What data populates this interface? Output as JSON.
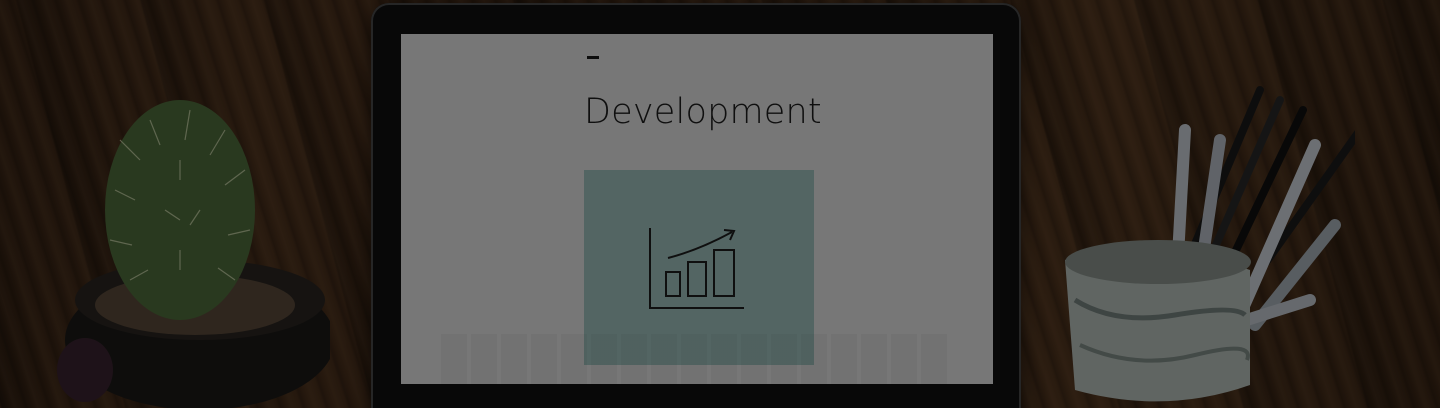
{
  "screen": {
    "dash_text": "–",
    "heading": "Development",
    "tile_icon": "growth-chart-icon"
  },
  "colors": {
    "screen_bg": "#e4e4e4",
    "tile_bg": "#9fc2bf",
    "desk_wood": "#4d321d",
    "overlay": "rgba(0,0,0,0.48)"
  }
}
